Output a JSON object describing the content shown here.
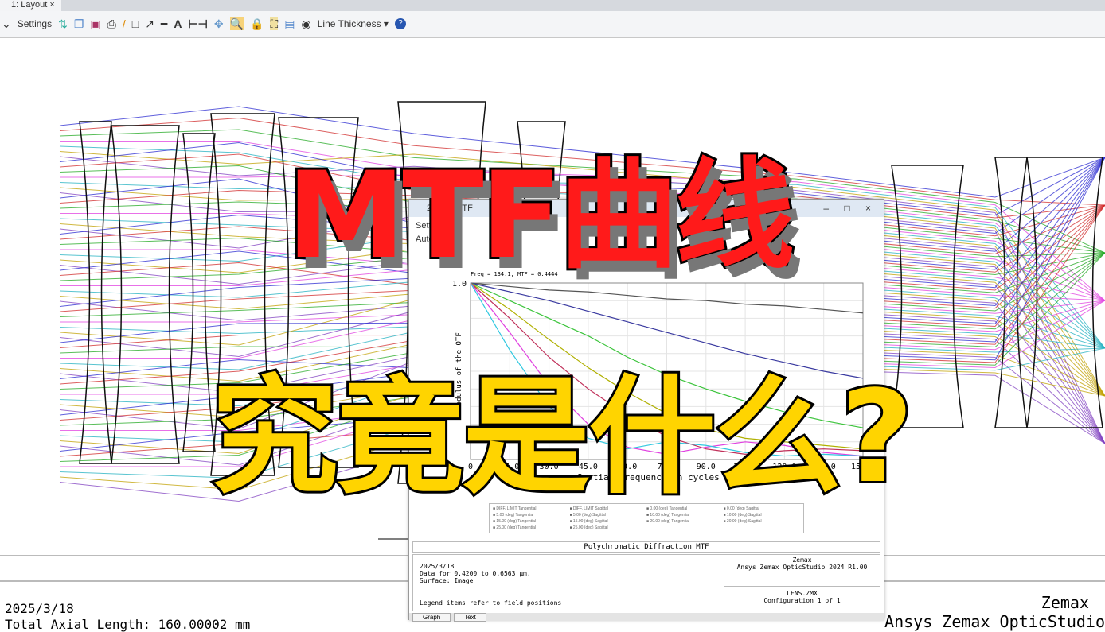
{
  "tab": {
    "label": "1: Layout",
    "close": "×"
  },
  "toolbar": {
    "settings": "Settings",
    "line_thickness": "Line Thickness ▾",
    "help": "?"
  },
  "bottom": {
    "date": "2025/3/18",
    "axial": "Total Axial Length:  160.00002 mm",
    "brand": "Zemax",
    "product": "Ansys Zemax OpticStudio"
  },
  "mtf_window": {
    "title": "2: FFT MTF",
    "settings": "Settings",
    "auto": "Automatic",
    "controls": "–  □  ×",
    "plot_title": "Polychromatic Diffraction MTF",
    "info_date": "2025/3/18",
    "info_data": "Data for 0.4200 to 0.6563 µm.",
    "info_surface": "Surface: Image",
    "info_legend": "Legend items refer to field positions",
    "brand": "Zemax",
    "product": "Ansys Zemax OpticStudio 2024 R1.00",
    "file": "LENS.ZMX",
    "config": "Configuration 1 of 1",
    "tabs": [
      "Graph",
      "Text"
    ],
    "legend": [
      "DIFF. LIMIT Tangential",
      "DIFF. LIMIT Sagittal",
      "0.00 (deg) Tangential",
      "0.00 (deg) Sagittal",
      "5.00 (deg) Tangential",
      "5.00 (deg) Sagittal",
      "10.00 (deg) Tangential",
      "10.00 (deg) Sagittal",
      "15.00 (deg) Tangential",
      "15.00 (deg) Sagittal",
      "20.00 (deg) Tangential",
      "20.00 (deg) Sagittal",
      "25.00 (deg) Tangential",
      "25.00 (deg) Sagittal"
    ]
  },
  "overlay": {
    "line1": "MTF曲线",
    "line2": "究竟是什么?"
  },
  "chart_data": {
    "type": "line",
    "title": "Polychromatic Diffraction MTF",
    "annotation": "Freq = 134.1, MTF = 0.4444",
    "xlabel": "Spatial Frequency in cycles per mm",
    "ylabel": "Modulus of the OTF",
    "xlim": [
      0,
      150
    ],
    "ylim": [
      0,
      1
    ],
    "xticks": [
      "0",
      "15.0",
      "30.0",
      "45.0",
      "60.0",
      "75.0",
      "90.0",
      "105.0",
      "120.0",
      "135.0",
      "150.0"
    ],
    "yticks": [
      "1.0"
    ],
    "x": [
      0,
      15,
      30,
      45,
      60,
      75,
      90,
      105,
      120,
      135,
      150
    ],
    "series": [
      {
        "name": "Diff. limit",
        "color": "#555555",
        "values": [
          1,
          0.98,
          0.96,
          0.95,
          0.93,
          0.91,
          0.9,
          0.88,
          0.87,
          0.85,
          0.83
        ]
      },
      {
        "name": "0.00 deg T",
        "color": "#3a3aa0",
        "values": [
          1,
          0.95,
          0.9,
          0.84,
          0.78,
          0.72,
          0.66,
          0.6,
          0.55,
          0.5,
          0.46
        ]
      },
      {
        "name": "5.00 deg T",
        "color": "#3cc43c",
        "values": [
          1,
          0.9,
          0.8,
          0.7,
          0.58,
          0.48,
          0.4,
          0.33,
          0.27,
          0.22,
          0.18
        ]
      },
      {
        "name": "10.00 deg T",
        "color": "#b0b000",
        "values": [
          1,
          0.85,
          0.68,
          0.52,
          0.38,
          0.26,
          0.17,
          0.12,
          0.1,
          0.08,
          0.06
        ]
      },
      {
        "name": "15.00 deg T",
        "color": "#c0305a",
        "values": [
          1,
          0.8,
          0.58,
          0.4,
          0.25,
          0.13,
          0.06,
          0.03,
          0.05,
          0.06,
          0.05
        ]
      },
      {
        "name": "20.00 deg T",
        "color": "#e040e0",
        "values": [
          1,
          0.72,
          0.42,
          0.2,
          0.07,
          0.03,
          0.07,
          0.1,
          0.08,
          0.04,
          0.02
        ]
      },
      {
        "name": "25.00 deg T",
        "color": "#30c8e0",
        "values": [
          1,
          0.62,
          0.3,
          0.12,
          0.06,
          0.1,
          0.08,
          0.04,
          0.02,
          0.03,
          0.02
        ]
      }
    ]
  }
}
